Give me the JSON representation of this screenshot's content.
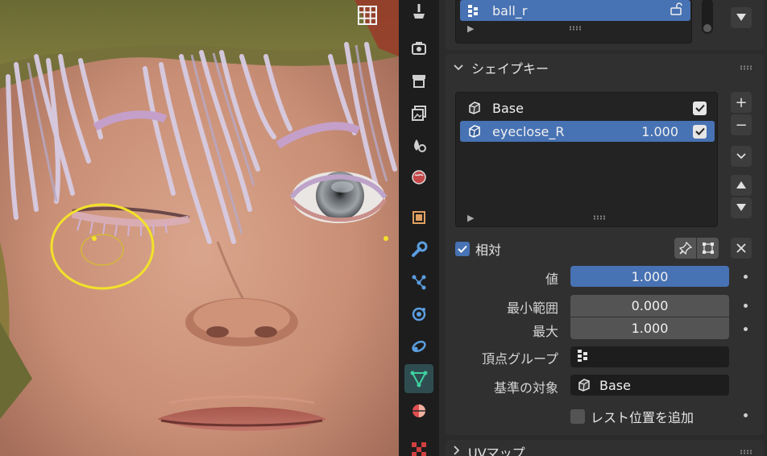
{
  "viewport": {
    "grid_button_icon": "viewport-grid-icon",
    "object_description": "close-up of a 3D character face with left eye closed via shape key"
  },
  "tabbar": {
    "tabs": [
      {
        "icon": "tool-icon",
        "active": false
      },
      {
        "icon": "render-icon",
        "active": false
      },
      {
        "icon": "output-icon",
        "active": false
      },
      {
        "icon": "view-layer-icon",
        "active": false
      },
      {
        "icon": "scene-icon",
        "active": false
      },
      {
        "icon": "world-icon",
        "active": false
      },
      {
        "icon": "object-icon",
        "active": false
      },
      {
        "icon": "modifier-wrench-icon",
        "active": false
      },
      {
        "icon": "particles-icon",
        "active": false
      },
      {
        "icon": "physics-icon",
        "active": false
      },
      {
        "icon": "constraints-icon",
        "active": false
      },
      {
        "icon": "object-data-mesh-icon",
        "active": true
      },
      {
        "icon": "material-icon",
        "active": false
      },
      {
        "icon": "texture-icon",
        "active": false
      }
    ]
  },
  "vertex_groups": {
    "selected_item": "ball_r"
  },
  "shape_keys": {
    "title": "シェイプキー",
    "items": [
      {
        "name": "Base",
        "value": "",
        "checked": true,
        "selected": false
      },
      {
        "name": "eyeclose_R",
        "value": "1.000",
        "checked": true,
        "selected": true
      }
    ],
    "add_label": "+",
    "remove_label": "−",
    "relative_label": "相対",
    "relative_checked": true,
    "fields": {
      "value_label": "値",
      "value": "1.000",
      "range_min_label": "最小範囲",
      "range_min": "0.000",
      "max_label": "最大",
      "max": "1.000",
      "vertex_group_label": "頂点グループ",
      "vertex_group": "",
      "relative_to_label": "基準の対象",
      "relative_to": "Base"
    },
    "rest_position_label": "レスト位置を追加",
    "rest_position_checked": false
  },
  "uv_maps": {
    "title": "UVマップ"
  }
}
